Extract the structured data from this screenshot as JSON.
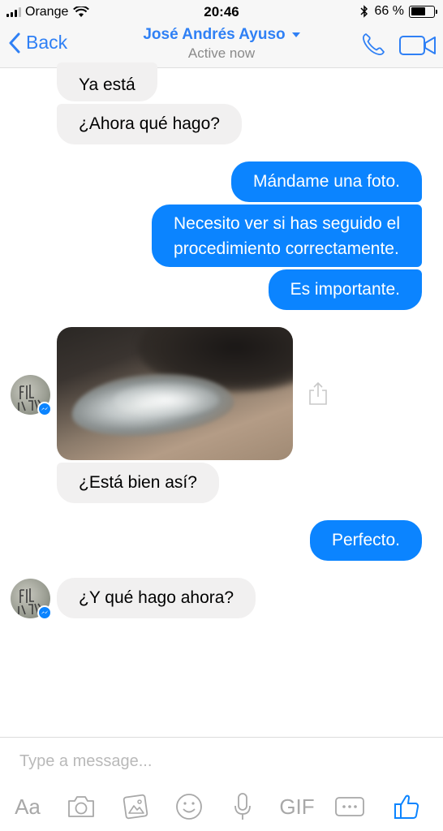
{
  "status_bar": {
    "carrier": "Orange",
    "time": "20:46",
    "battery_percent": "66 %",
    "battery_level": 0.66
  },
  "nav": {
    "back_label": "Back",
    "contact_name": "José Andrés Ayuso",
    "contact_status": "Active now",
    "accent_color": "#2f80f5"
  },
  "messages": [
    {
      "sender": "contact",
      "text": "Ya está"
    },
    {
      "sender": "contact",
      "text": "¿Ahora qué hago?"
    },
    {
      "sender": "me",
      "text": "Mándame una foto."
    },
    {
      "sender": "me",
      "text": "Necesito ver si has seguido el",
      "text_line2": "procedimiento correctamente."
    },
    {
      "sender": "me",
      "text": "Es importante."
    },
    {
      "sender": "contact",
      "type": "photo"
    },
    {
      "sender": "contact",
      "text": "¿Está bien así?"
    },
    {
      "sender": "me",
      "text": "Perfecto."
    },
    {
      "sender": "contact",
      "text": "¿Y qué hago ahora?"
    }
  ],
  "composer": {
    "placeholder": "Type a message...",
    "aa_label": "Aa",
    "gif_label": "GIF"
  },
  "colors": {
    "outgoing_bubble": "#0b84ff",
    "incoming_bubble": "#f1f0f0"
  },
  "icons": [
    "back-chevron-icon",
    "phone-icon",
    "video-camera-icon",
    "share-icon",
    "camera-icon",
    "gallery-icon",
    "emoji-icon",
    "microphone-icon",
    "more-icon",
    "thumbs-up-icon",
    "messenger-icon"
  ]
}
